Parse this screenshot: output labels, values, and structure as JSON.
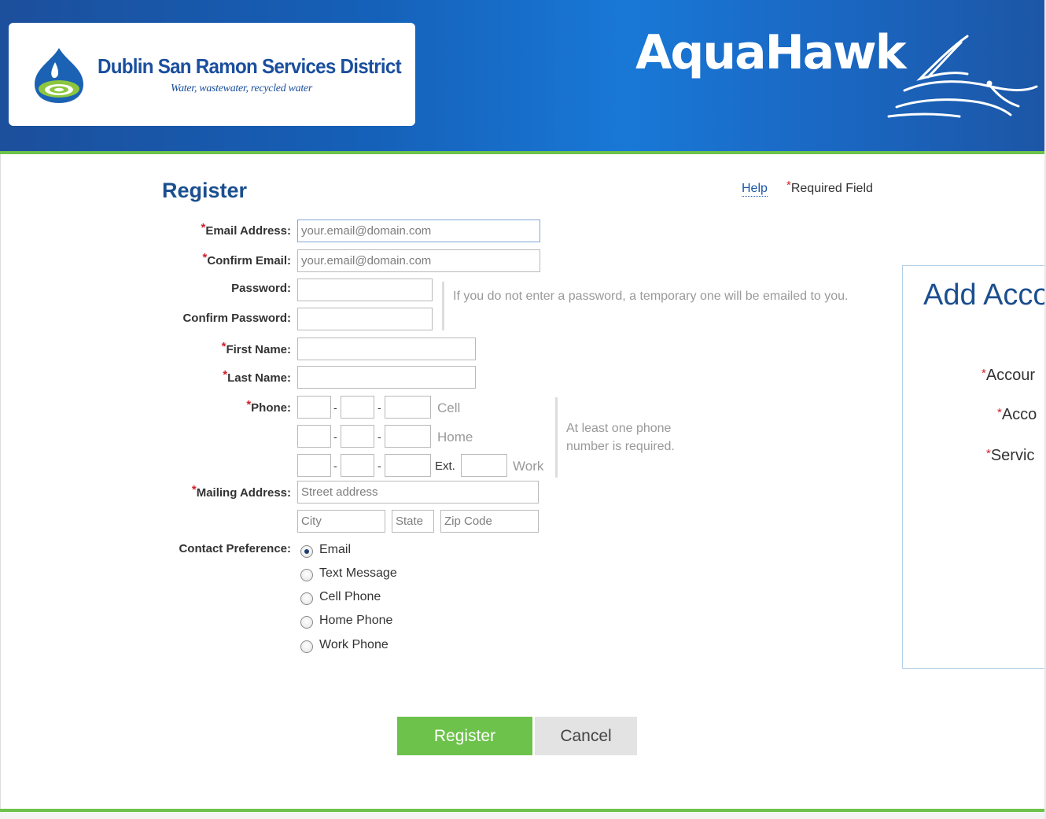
{
  "header": {
    "org_name": "Dublin San Ramon Services District",
    "org_tagline": "Water, wastewater, recycled water",
    "brand_title": "AquaHawk",
    "colors": {
      "header_blue": "#1560b8",
      "accent_green": "#6cc24a"
    }
  },
  "form": {
    "title": "Register",
    "help_link": "Help",
    "required_note": "Required Field",
    "required_marker": "*",
    "labels": {
      "email": "Email Address:",
      "confirm_email": "Confirm Email:",
      "password": "Password:",
      "confirm_password": "Confirm Password:",
      "first_name": "First Name:",
      "last_name": "Last Name:",
      "phone": "Phone:",
      "mailing_address": "Mailing Address:",
      "contact_preference": "Contact Preference:"
    },
    "placeholders": {
      "email": "your.email@domain.com",
      "confirm_email": "your.email@domain.com",
      "street": "Street address",
      "city": "City",
      "state": "State",
      "zip": "Zip Code"
    },
    "password_hint": "If you do not enter a password, a temporary one will be emailed to you.",
    "phone_hint": "At least one phone number is required.",
    "phone_separator": "-",
    "phone_rows": [
      {
        "type": "Cell"
      },
      {
        "type": "Home"
      },
      {
        "type": "Work",
        "ext_label": "Ext."
      }
    ],
    "contact_options": [
      {
        "label": "Email",
        "selected": true
      },
      {
        "label": "Text Message",
        "selected": false
      },
      {
        "label": "Cell Phone",
        "selected": false
      },
      {
        "label": "Home Phone",
        "selected": false
      },
      {
        "label": "Work Phone",
        "selected": false
      }
    ],
    "buttons": {
      "register": "Register",
      "cancel": "Cancel"
    }
  },
  "add_account_panel": {
    "title": "Add Acco",
    "fields": [
      "Accour",
      "Acco",
      "Servic"
    ]
  }
}
